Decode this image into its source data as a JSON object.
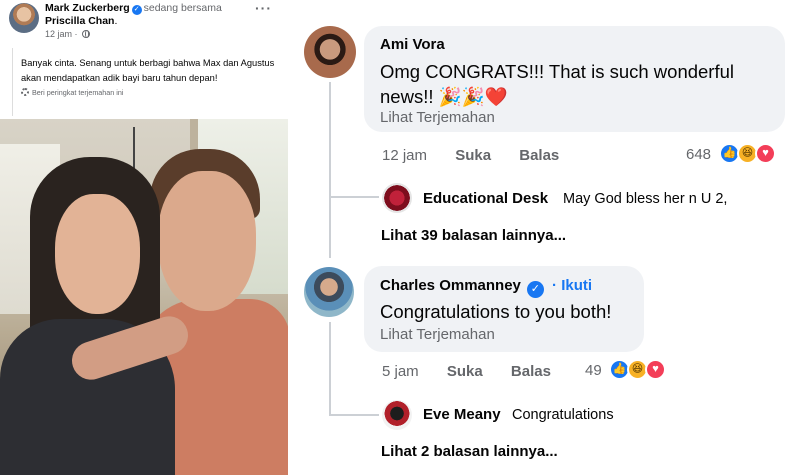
{
  "post": {
    "author": "Mark Zuckerberg",
    "with_text": "sedang bersama",
    "tagged": "Priscilla Chan",
    "tagged_suffix": ".",
    "time": "12 jam",
    "caption": "Banyak cinta. Senang untuk berbagi bahwa Max dan Agustus akan mendapatkan adik bayi baru tahun depan!",
    "translation_rating": "Beri peringkat terjemahan ini"
  },
  "comments": [
    {
      "name": "Ami Vora",
      "text": "Omg CONGRATS!!! That is such wonderful news!! 🎉🎉❤️",
      "translate": "Lihat Terjemahan",
      "time": "12 jam",
      "like": "Suka",
      "reply": "Balas",
      "reactions": "648",
      "reply_preview": {
        "name": "Educational Desk",
        "text": "May God bless her n U 2,"
      },
      "more_replies": "Lihat 39 balasan lainnya..."
    },
    {
      "name": "Charles Ommanney",
      "follow": "Ikuti",
      "text": "Congratulations to you both!",
      "translate": "Lihat Terjemahan",
      "time": "5 jam",
      "like": "Suka",
      "reply": "Balas",
      "reactions": "49",
      "reply_preview": {
        "name": "Eve Meany",
        "text": "Congratulations"
      },
      "more_replies": "Lihat 2 balasan lainnya..."
    }
  ],
  "colors": {
    "link": "#1877f2",
    "bubble": "#f0f2f5",
    "muted": "#65676b"
  },
  "icons": [
    "verified-badge-icon",
    "globe-icon",
    "more-options-icon",
    "gear-icon",
    "like-reaction-icon",
    "haha-reaction-icon",
    "love-reaction-icon"
  ]
}
